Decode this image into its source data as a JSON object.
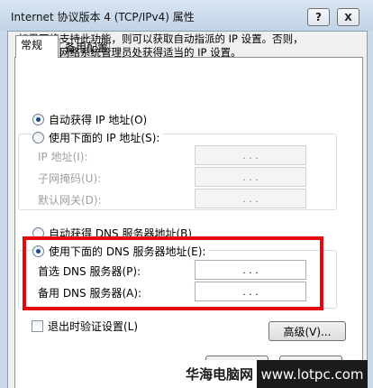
{
  "window": {
    "title": "Internet 协议版本 4 (TCP/IPv4) 属性",
    "help_glyph": "?",
    "close_glyph": "X"
  },
  "tabs": [
    {
      "label": "常规"
    },
    {
      "label": "备用配置"
    }
  ],
  "description_line1": "如果网络支持此功能，则可以获取自动指派的 IP 设置。否则，",
  "description_line2": "您需要从网络系统管理员处获得适当的 IP 设置。",
  "ip": {
    "auto_label": "自动获得 IP 地址(O)",
    "manual_label": "使用下面的 IP 地址(S):",
    "auto_selected": true,
    "fields": [
      {
        "label": "IP 地址(I):",
        "value": ". . ."
      },
      {
        "label": "子网掩码(U):",
        "value": ". . ."
      },
      {
        "label": "默认网关(D):",
        "value": ". . ."
      }
    ]
  },
  "dns": {
    "auto_label": "自动获得 DNS 服务器地址(B)",
    "manual_label": "使用下面的 DNS 服务器地址(E):",
    "manual_selected": true,
    "fields": [
      {
        "label": "首选 DNS 服务器(P):",
        "value": ". . ."
      },
      {
        "label": "备用 DNS 服务器(A):",
        "value": ". . ."
      }
    ]
  },
  "validate_on_exit_label": "退出时验证设置(L)",
  "validate_on_exit_checked": false,
  "advanced_button": "高级(V)...",
  "watermark": {
    "left_text": "华海电脑网",
    "right_text": "www.lotpc.com"
  },
  "colors": {
    "highlight_box": "#e5080c",
    "radio_selected": "#1b4a86"
  }
}
